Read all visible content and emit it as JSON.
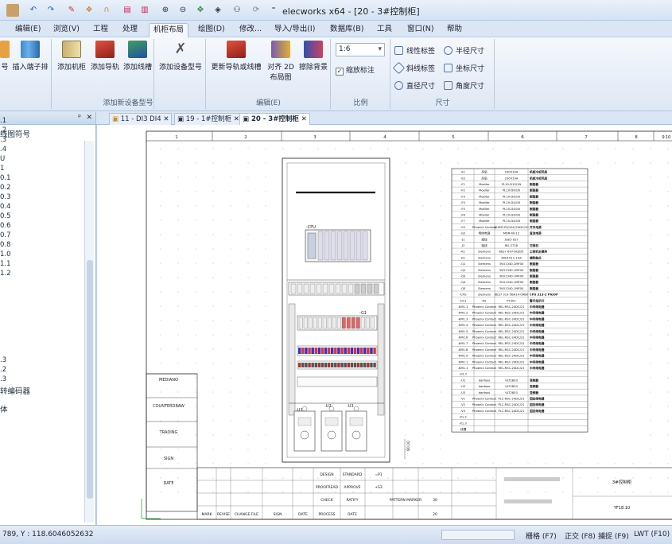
{
  "app": {
    "title": "elecworks x64 - [20 - 3#控制柜]"
  },
  "menu": {
    "items": [
      "编辑(E)",
      "浏览(V)",
      "工程",
      "处理",
      "机柜布局",
      "绘图(D)",
      "修改...",
      "导入/导出(I)",
      "数据库(B)",
      "工具",
      "窗口(N)",
      "帮助"
    ],
    "active_index": 4
  },
  "ribbon": {
    "left_partial": "号",
    "terminal_strip": "插入端子排",
    "add_cabinet": "添加机柜",
    "add_rail": "添加导轨",
    "add_duct": "添加线槽",
    "add_device": "添加设备型号",
    "group_add": "添加新设备型号",
    "update_rail": "更新导轨或线槽",
    "align_2d_line1": "对齐 2D",
    "align_2d_line2": "布局图",
    "erase_bg": "擦除背景",
    "group_edit": "编辑(E)",
    "scale_value": "1:6",
    "scale_check": "缩放标注",
    "group_scale": "比例",
    "line_label": "线性标签",
    "radius_dim": "半径尺寸",
    "oblique_label": "斜线标签",
    "coord_dim": "坐标尺寸",
    "diameter_dim": "直径尺寸",
    "angle_dim": "角度尺寸",
    "group_dim": "尺寸"
  },
  "left_panel": {
    "pin": "ᵖ",
    "close": "✕",
    "header": "线图符号",
    "items": [
      ".1",
      ".2",
      ".3",
      ".4",
      "U",
      "1",
      "0.1",
      "0.2",
      "0.3",
      "0.4",
      "0.5",
      "0.6",
      "0.7",
      "0.8",
      "1.0",
      "1.1",
      "1.2",
      ".3",
      ".2",
      ".3",
      "转编码器",
      "体"
    ]
  },
  "doc_tabs": [
    {
      "label": "11 - DI3 DI4",
      "close": "✕",
      "active": false
    },
    {
      "label": "19 - 1#控制柜",
      "close": "✕",
      "active": false
    },
    {
      "label": "20 - 3#控制柜",
      "close": "✕",
      "active": true
    }
  ],
  "drawing": {
    "columns": [
      "1",
      "2",
      "3",
      "4",
      "5",
      "6",
      "7",
      "8",
      "9",
      "10"
    ],
    "side_labels": [
      "MEDIANO",
      "COUNTERDRAW",
      "TRADING",
      "SIGN",
      "DATE"
    ],
    "title_block": {
      "design": "DESIGN",
      "proofread": "PROOFREAD",
      "check": "CHECK",
      "process": "PROCESS",
      "standard": "STANDARD",
      "approve": "APPROVE",
      "ratify": "RATIFY",
      "date": "DATE",
      "mark": "MARK",
      "revise": "REVISE",
      "change_file": "CHANGE FILE",
      "sign": "SIGN",
      "pattern_marker": "PATTERN MARKER",
      "num1": "30",
      "num2": "20",
      "dash1": "=P1",
      "dash2": "+S3",
      "sheet_name": "3#控制柜",
      "sheet_code": "YF18.10"
    },
    "bom_rows": [
      [
        "-E1",
        "风扇",
        "230V10A",
        "机柜冷却风扇"
      ],
      [
        "-E2",
        "风扇",
        "230V10A",
        "机柜冷却风扇"
      ],
      [
        "-F1",
        "Moeller",
        "PL10-D10/1N",
        "断路器"
      ],
      [
        "-F2",
        "Moeller",
        "PL10-D4/1N",
        "断路器"
      ],
      [
        "-F3",
        "Moeller",
        "PL10-D4/1N",
        "断路器"
      ],
      [
        "-F4",
        "Moeller",
        "PL10-D4/1N",
        "断路器"
      ],
      [
        "-F5",
        "Moeller",
        "PL10-D4/1N",
        "断路器"
      ],
      [
        "-F6",
        "Moeller",
        "PL10-D4/1N",
        "断路器"
      ],
      [
        "-F7",
        "Moeller",
        "PL10-D4/1N",
        "断路器"
      ],
      [
        "-G1",
        "Phoenix Contact",
        "QUINT-PS/1AC/24DC/10",
        "开关电源"
      ],
      [
        "-G2",
        "明纬电源",
        "MDR-40-12",
        "直流电源"
      ],
      [
        "-J1",
        "接线",
        "3SE5 027",
        ""
      ],
      [
        "-J2",
        "接线",
        "BG-2728",
        "交换机"
      ],
      [
        "-K1",
        "Siemens",
        "6ES7 647-6CB35",
        "工控机主模块"
      ],
      [
        "-K1",
        "Siemens",
        "3RH1911-1HA",
        "辅助触点"
      ],
      [
        "-Q1",
        "Siemens",
        "3VU1340-1MF00",
        "断路器"
      ],
      [
        "-Q2",
        "Siemens",
        "3VU1340-1MF00",
        "断路器"
      ],
      [
        "-Q3",
        "Siemens",
        "3VU1340-1MF00",
        "断路器"
      ],
      [
        "-Q4",
        "Siemens",
        "3VU1340-1MF00",
        "断路器"
      ],
      [
        "-Q5",
        "Siemens",
        "3VU1340-1MF00",
        "断路器"
      ],
      [
        "-CPU",
        "Siemens",
        "6ES7 313-5BH14-0AB0",
        "CPU 313-2 PN/DP"
      ],
      [
        "-H11",
        "RS",
        "PT301",
        "警示指示灯"
      ],
      [
        "-KM1.1",
        "Phoenix Contact",
        "REL-RSC-24DC/21",
        "中间继电器"
      ],
      [
        "-KM1.2",
        "Phoenix Contact",
        "REL-RSC-24DC/21",
        "中间继电器"
      ],
      [
        "-KM1.3",
        "Phoenix Contact",
        "REL-RSC-24DC/21",
        "中间继电器"
      ],
      [
        "-KM1.4",
        "Phoenix Contact",
        "REL-RSC-24DC/21",
        "中间继电器"
      ],
      [
        "-KM1.5",
        "Phoenix Contact",
        "REL-RSC-24DC/21",
        "中间继电器"
      ],
      [
        "-KM1.6",
        "Phoenix Contact",
        "REL-RSC-24DC/21",
        "中间继电器"
      ],
      [
        "-KM1.7",
        "Phoenix Contact",
        "REL-RSC-24DC/21",
        "中间继电器"
      ],
      [
        "-KM1.8",
        "Phoenix Contact",
        "REL-RSC-24DC/21",
        "中间继电器"
      ],
      [
        "-KM1.9",
        "Phoenix Contact",
        "REL-RSC-24DC/21",
        "中间继电器"
      ],
      [
        "-KM1.1",
        "Phoenix Contact",
        "REL-RSC-24DC/21",
        "中间继电器"
      ],
      [
        "-KM1.1",
        "Phoenix Contact",
        "REL-RSC-24DC/21",
        "中间继电器"
      ],
      [
        "-S3.3",
        "",
        "",
        ""
      ],
      [
        "-U1",
        "danfoss",
        "VLT2803",
        "变频器"
      ],
      [
        "-U2",
        "danfoss",
        "VLT2803",
        "变频器"
      ],
      [
        "-U3",
        "danfoss",
        "VLT2803",
        "变频器"
      ],
      [
        "-V1",
        "Phoenix Contact",
        "PLC-RSC-24DC/21",
        "固态继电器"
      ],
      [
        "-V2",
        "Phoenix Contact",
        "PLC-RSC-24DC/21",
        "固态继电器"
      ],
      [
        "-V3",
        "Phoenix Contact",
        "PLC-RSC-24DC/21",
        "固态继电器"
      ],
      [
        "-X1.2",
        "",
        "",
        ""
      ],
      [
        "-X1.3",
        "",
        "",
        ""
      ],
      [
        "-线槽",
        "",
        "",
        ""
      ]
    ],
    "cabinet_labels": {
      "cpu": "-CPU",
      "g1": "-G1",
      "u1": "-U1",
      "u2": "-U2",
      "u3": "-U3",
      "dim": "80.00"
    }
  },
  "status": {
    "coords": "789, Y : 118.6046052632",
    "grid": "栅格 (F7)",
    "ortho": "正交 (F8)",
    "snap": "捕捉 (F9)",
    "lwt": "LWT (F10)"
  }
}
